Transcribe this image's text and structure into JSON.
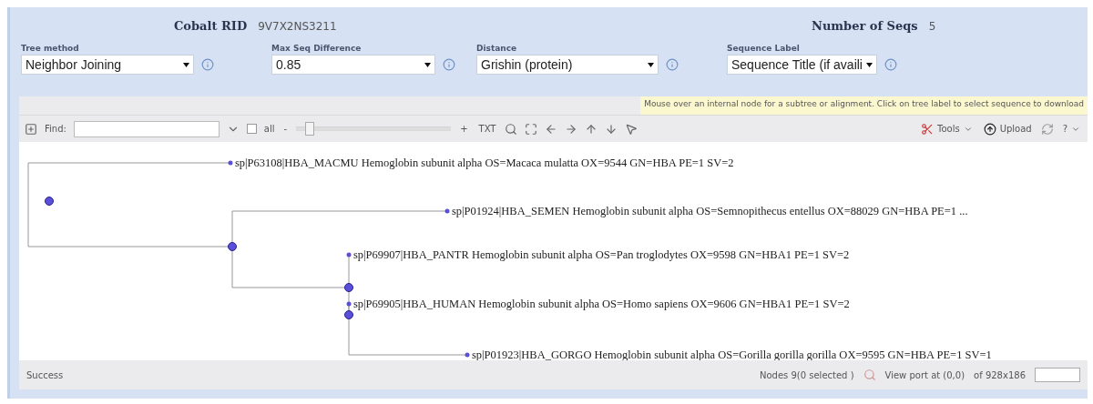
{
  "header": {
    "rid_label": "Cobalt RID",
    "rid": "9V7X2NS3211",
    "seqs_label": "Number of Seqs",
    "seqs": "5"
  },
  "options": [
    {
      "label": "Tree method",
      "value": "Neighbor Joining"
    },
    {
      "label": "Max Seq Difference",
      "value": "0.85"
    },
    {
      "label": "Distance",
      "value": "Grishin (protein)"
    },
    {
      "label": "Sequence Label",
      "value": "Sequence Title (if availi"
    }
  ],
  "hint": "Mouse over an internal node for a subtree or alignment. Click on tree label to select sequence to download",
  "toolbar": {
    "find_label": "Find:",
    "all_label": "all",
    "all_checked": false,
    "zoom_out": "-",
    "zoom": {
      "level": 0.06
    },
    "zoom_in": "+",
    "txt": "TXT",
    "tools": "Tools",
    "upload": "Upload",
    "help": "?"
  },
  "tree": {
    "children": [
      {
        "label": "sp|P63108|HBA_MACMU Hemoglobin subunit alpha OS=Macaca mulatta OX=9544 GN=HBA PE=1 SV=2"
      },
      {
        "children": [
          {
            "label": "sp|P01924|HBA_SEMEN Hemoglobin subunit alpha OS=Semnopithecus entellus OX=88029 GN=HBA PE=1 ..."
          },
          {
            "children": [
              {
                "label": "sp|P69907|HBA_PANTR Hemoglobin subunit alpha OS=Pan troglodytes OX=9598 GN=HBA1 PE=1 SV=2"
              },
              {
                "children": [
                  {
                    "label": "sp|P69905|HBA_HUMAN Hemoglobin subunit alpha OS=Homo sapiens OX=9606 GN=HBA1 PE=1 SV=2"
                  },
                  {
                    "label": "sp|P01923|HBA_GORGO Hemoglobin subunit alpha OS=Gorilla gorilla gorilla OX=9595 GN=HBA PE=1 SV=1"
                  }
                ]
              }
            ]
          }
        ]
      }
    ]
  },
  "status": {
    "message": "Success",
    "nodes": "Nodes 9(0 selected )",
    "viewport": "View port at (0,0)",
    "size": "of 928x186"
  }
}
